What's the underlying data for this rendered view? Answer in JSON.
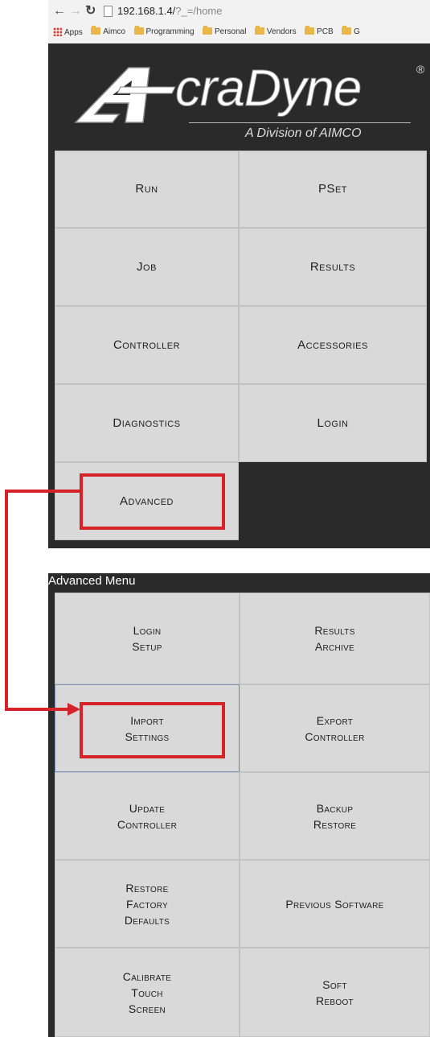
{
  "browser": {
    "url_host": "192.168.1.4/",
    "url_path": "?_=/home",
    "bookmarks": [
      "Apps",
      "Aimco",
      "Programming",
      "Personal",
      "Vendors",
      "PCB",
      "G"
    ]
  },
  "logo": {
    "brand": "craDyne",
    "registered": "®",
    "subtitle": "A Division of AIMCO"
  },
  "home_menu": {
    "items": [
      {
        "label": "Run"
      },
      {
        "label": "PSet"
      },
      {
        "label": "Job"
      },
      {
        "label": "Results"
      },
      {
        "label": "Controller"
      },
      {
        "label": "Accessories"
      },
      {
        "label": "Diagnostics"
      },
      {
        "label": "Login"
      },
      {
        "label": "Advanced"
      }
    ]
  },
  "advanced_menu": {
    "title": "Advanced Menu",
    "items": [
      {
        "line1": "Login",
        "line2": "Setup",
        "line3": ""
      },
      {
        "line1": "Results",
        "line2": "Archive",
        "line3": ""
      },
      {
        "line1": "Import",
        "line2": "Settings",
        "line3": ""
      },
      {
        "line1": "Export",
        "line2": "Controller",
        "line3": ""
      },
      {
        "line1": "Update",
        "line2": "Controller",
        "line3": ""
      },
      {
        "line1": "Backup",
        "line2": "Restore",
        "line3": ""
      },
      {
        "line1": "Restore",
        "line2": "Factory",
        "line3": "Defaults"
      },
      {
        "line1": "Previous Software",
        "line2": "",
        "line3": ""
      },
      {
        "line1": "Calibrate",
        "line2": "Touch",
        "line3": "Screen"
      },
      {
        "line1": "Soft",
        "line2": "Reboot",
        "line3": ""
      }
    ]
  },
  "colors": {
    "panel_background": "#2a2a2a",
    "tile_background": "#d9d9d9",
    "highlight": "#d6232a",
    "selected_border": "#7a93b8"
  }
}
